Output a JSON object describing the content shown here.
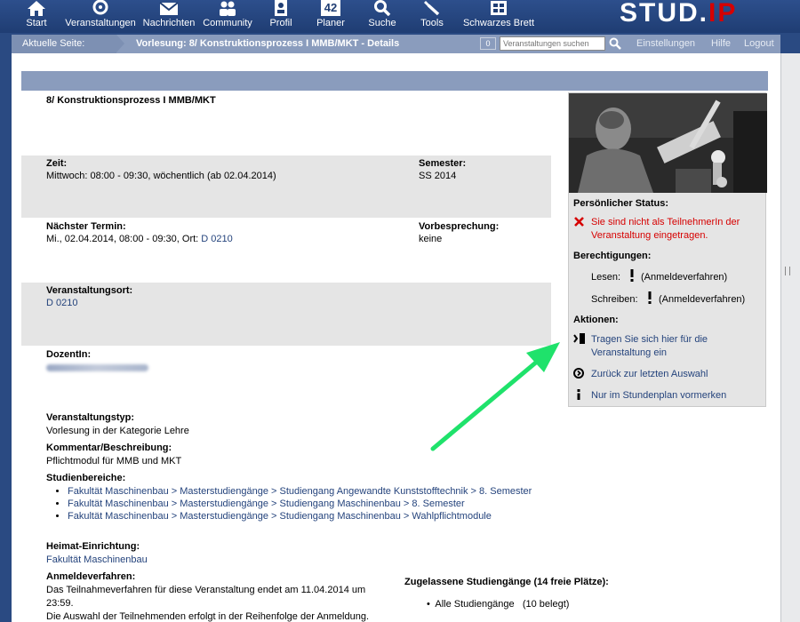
{
  "nav": {
    "items": [
      {
        "label": "Start",
        "icon": "home-icon"
      },
      {
        "label": "Veranstaltungen",
        "icon": "courses-icon"
      },
      {
        "label": "Nachrichten",
        "icon": "mail-icon"
      },
      {
        "label": "Community",
        "icon": "community-icon"
      },
      {
        "label": "Profil",
        "icon": "profile-icon"
      },
      {
        "label": "Planer",
        "icon": "calendar-icon"
      },
      {
        "label": "Suche",
        "icon": "search-icon"
      },
      {
        "label": "Tools",
        "icon": "wrench-icon"
      },
      {
        "label": "Schwarzes Brett",
        "icon": "board-icon"
      }
    ],
    "planer_day": "42",
    "logo_main": "STUD.",
    "logo_tail": "IP"
  },
  "breadcrumb": {
    "label": "Aktuelle Seite:",
    "current": "Vorlesung: 8/ Konstruktionsprozess I MMB/MKT - Details",
    "count": "0",
    "search_placeholder": "Veranstaltungen suchen",
    "links": [
      "Einstellungen",
      "Hilfe",
      "Logout"
    ]
  },
  "course": {
    "title": "8/ Konstruktionsprozess I MMB/MKT",
    "zeit_label": "Zeit:",
    "zeit_value": "Mittwoch: 08:00 - 09:30, wöchentlich (ab 02.04.2014)",
    "semester_label": "Semester:",
    "semester_value": "SS 2014",
    "naechster_label": "Nächster Termin:",
    "naechster_value": "Mi., 02.04.2014, 08:00 - 09:30, Ort:",
    "naechster_room": "D 0210",
    "vorbesprechung_label": "Vorbesprechung:",
    "vorbesprechung_value": "keine",
    "ort_label": "Veranstaltungsort:",
    "ort_value": "D 0210",
    "dozent_label": "DozentIn:",
    "typ_label": "Veranstaltungstyp:",
    "typ_value": "Vorlesung in der Kategorie Lehre",
    "kommentar_label": "Kommentar/Beschreibung:",
    "kommentar_value": "Pflichtmodul für MMB und MKT",
    "studienbereiche_label": "Studienbereiche:",
    "studienbereiche": [
      "Fakultät Maschinenbau > Masterstudiengänge > Studiengang Angewandte Kunststofftechnik > 8. Semester",
      "Fakultät Maschinenbau > Masterstudiengänge > Studiengang Maschinenbau > 8. Semester",
      "Fakultät Maschinenbau > Masterstudiengänge > Studiengang Maschinenbau > Wahlpflichtmodule"
    ],
    "heimat_label": "Heimat-Einrichtung:",
    "heimat_value": "Fakultät Maschinenbau",
    "anmelde_label": "Anmeldeverfahren:",
    "anmelde_line1": "Das Teilnahmeverfahren für diese Veranstaltung endet am 11.04.2014 um",
    "anmelde_line2": "23:59.",
    "anmelde_line3": "Die Auswahl der Teilnehmenden erfolgt in der Reihenfolge der Anmeldung.",
    "zugelassen_label": "Zugelassene Studiengänge (14 freie Plätze):",
    "zugelassen_item": "Alle Studiengänge",
    "zugelassen_count": "(10 belegt)"
  },
  "infobox": {
    "status_head": "Persönlicher Status:",
    "status_line1": "Sie sind nicht als TeilnehmerIn der",
    "status_line2": "Veranstaltung eingetragen.",
    "rights_head": "Berechtigungen:",
    "lesen": "Lesen:",
    "lesen_note": "(Anmeldeverfahren)",
    "schreiben": "Schreiben:",
    "schreiben_note": "(Anmeldeverfahren)",
    "actions_head": "Aktionen:",
    "action1_line1": "Tragen Sie sich hier für die",
    "action1_line2": "Veranstaltung ein",
    "action2": "Zurück zur letzten Auswahl",
    "action3": "Nur im Stundenplan vormerken"
  },
  "colors": {
    "nav_bg": "#1f3d73",
    "crumb_bg": "#8a9cbd",
    "link": "#24437c",
    "error": "#d60000",
    "arrow": "#1fe26b"
  }
}
